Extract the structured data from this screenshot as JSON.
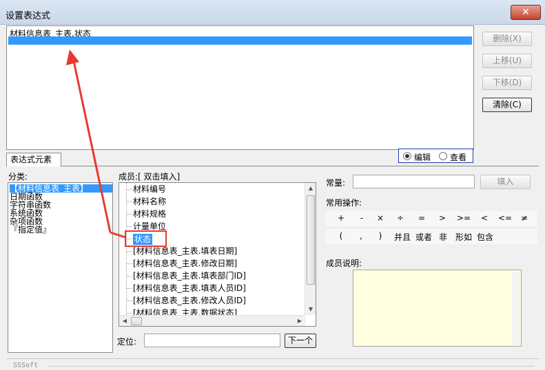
{
  "window": {
    "title": "设置表达式",
    "close_label": "✕"
  },
  "expression": {
    "line1": "材料信息表_主表.状态"
  },
  "side_buttons": {
    "delete": "删除(X)",
    "move_up": "上移(U)",
    "move_down": "下移(D)",
    "clear": "清除(C)"
  },
  "mode": {
    "edit": "编辑",
    "view": "查看",
    "selected": "编辑"
  },
  "tab": {
    "label": "表达式元素"
  },
  "category": {
    "label": "分类:",
    "items": [
      "【材料信息表_主表】",
      "日期函数",
      "字符串函数",
      "系统函数",
      "杂项函数",
      "『指定值』"
    ]
  },
  "members": {
    "label": "成员:[ 双击填入]",
    "items": [
      "材料编号",
      "材料名称",
      "材料规格",
      "计量单位",
      "状态",
      "[材料信息表_主表.填表日期]",
      "[材料信息表_主表.修改日期]",
      "[材料信息表_主表.填表部门ID]",
      "[材料信息表_主表.填表人员ID]",
      "[材料信息表_主表.修改人员ID]",
      "[材料信息表_主表.数据状态]"
    ],
    "selected": "状态"
  },
  "locate": {
    "label": "定位:",
    "value": "",
    "next_button": "下一个"
  },
  "constant": {
    "label": "常量:",
    "value": "",
    "insert_button": "填入"
  },
  "operators": {
    "label": "常用操作:",
    "row1": [
      "+",
      "-",
      "×",
      "÷",
      "=",
      ">",
      ">=",
      "<",
      "<=",
      "≠"
    ],
    "row2": [
      "(",
      ",",
      ")",
      "并且",
      "或者",
      "非",
      "形如",
      "包含"
    ]
  },
  "description": {
    "label": "成员说明:",
    "text": ""
  },
  "status": {
    "text": "SSSoft"
  },
  "colors": {
    "selection": "#3399ff",
    "annotation_red": "#e8382f",
    "description_bg": "#ffffdf"
  }
}
